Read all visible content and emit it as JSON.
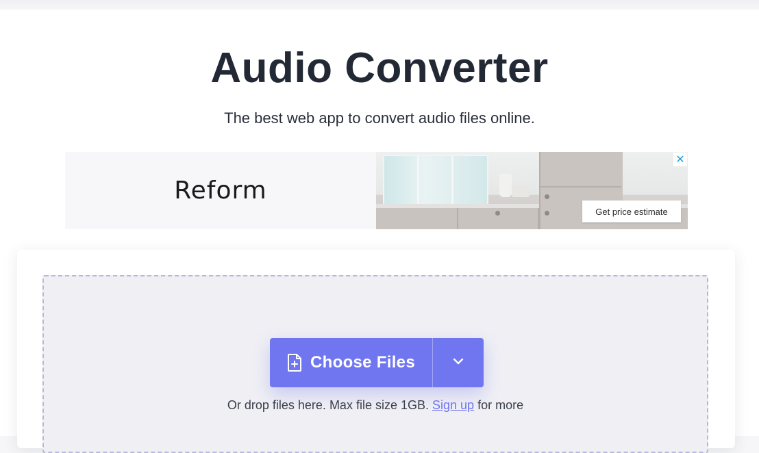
{
  "header": {
    "title": "Audio Converter",
    "subtitle": "The best web app to convert audio files online."
  },
  "ad": {
    "brand": "Reform",
    "cta_label": "Get price estimate",
    "close_glyph": "✕"
  },
  "uploader": {
    "choose_label": "Choose Files",
    "choose_icon": "file-plus-icon",
    "dropdown_icon": "chevron-down-icon",
    "hint_prefix": "Or drop files here. Max file size 1GB.",
    "signup_link": "Sign up",
    "hint_suffix": "for more"
  },
  "colors": {
    "accent": "#6f76ef",
    "title": "#222834",
    "dropzone_bg": "#efeff4",
    "dropzone_border": "#b9b6d8",
    "ad_close": "#1aa2dc"
  }
}
